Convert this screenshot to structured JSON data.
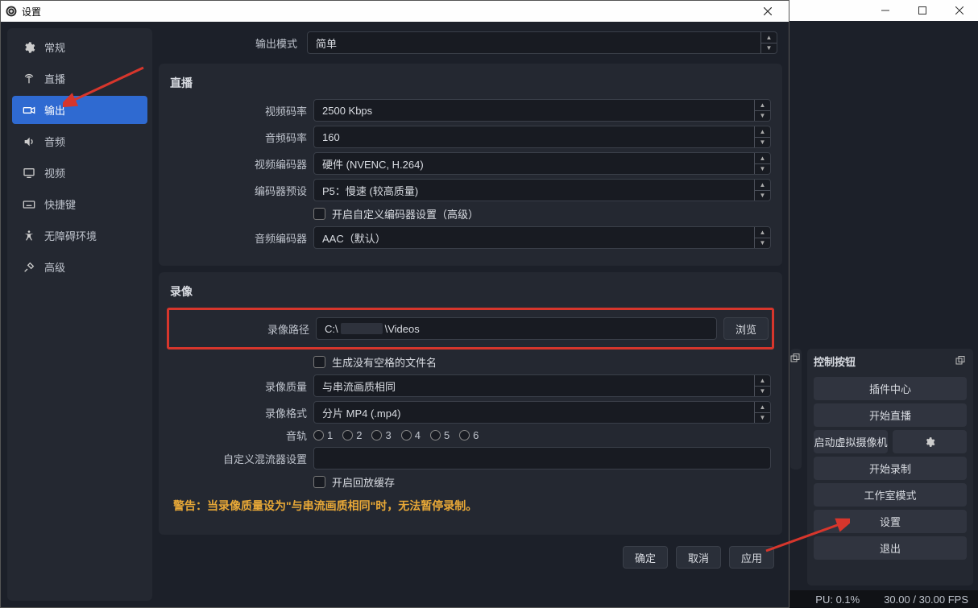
{
  "dialog_title": "设置",
  "sidebar": {
    "items": [
      {
        "label": "常规",
        "icon": "gear"
      },
      {
        "label": "直播",
        "icon": "antenna"
      },
      {
        "label": "输出",
        "icon": "output",
        "active": true
      },
      {
        "label": "音频",
        "icon": "speaker"
      },
      {
        "label": "视频",
        "icon": "monitor"
      },
      {
        "label": "快捷键",
        "icon": "keyboard"
      },
      {
        "label": "无障碍环境",
        "icon": "accessibility"
      },
      {
        "label": "高级",
        "icon": "tools"
      }
    ]
  },
  "output_mode": {
    "label": "输出模式",
    "value": "简单"
  },
  "stream": {
    "title": "直播",
    "video_bitrate": {
      "label": "视频码率",
      "value": "2500 Kbps"
    },
    "audio_bitrate": {
      "label": "音频码率",
      "value": "160"
    },
    "video_encoder": {
      "label": "视频编码器",
      "value": "硬件 (NVENC, H.264)"
    },
    "encoder_preset": {
      "label": "编码器预设",
      "value": "P5：慢速 (较高质量)"
    },
    "custom_encoder_check": "开启自定义编码器设置（高级）",
    "audio_encoder": {
      "label": "音频编码器",
      "value": "AAC（默认）"
    }
  },
  "record": {
    "title": "录像",
    "path": {
      "label": "录像路径",
      "value_prefix": "C:\\",
      "value_suffix": "\\Videos",
      "browse": "浏览"
    },
    "no_space_check": "生成没有空格的文件名",
    "quality": {
      "label": "录像质量",
      "value": "与串流画质相同"
    },
    "format": {
      "label": "录像格式",
      "value": "分片 MP4 (.mp4)"
    },
    "tracks": {
      "label": "音轨",
      "options": [
        "1",
        "2",
        "3",
        "4",
        "5",
        "6"
      ]
    },
    "mixer": {
      "label": "自定义混流器设置",
      "value": ""
    },
    "replay_buffer_check": "开启回放缓存"
  },
  "warn": "警告：当录像质量设为\"与串流画质相同\"时，无法暂停录制。",
  "buttons": {
    "ok": "确定",
    "cancel": "取消",
    "apply": "应用"
  },
  "control_dock": {
    "title": "控制按钮",
    "plugin_center": "插件中心",
    "start_stream": "开始直播",
    "start_vcam": "启动虚拟摄像机",
    "start_record": "开始录制",
    "studio_mode": "工作室模式",
    "settings": "设置",
    "exit": "退出"
  },
  "status": {
    "cpu": "PU: 0.1%",
    "fps": "30.00 / 30.00 FPS"
  }
}
